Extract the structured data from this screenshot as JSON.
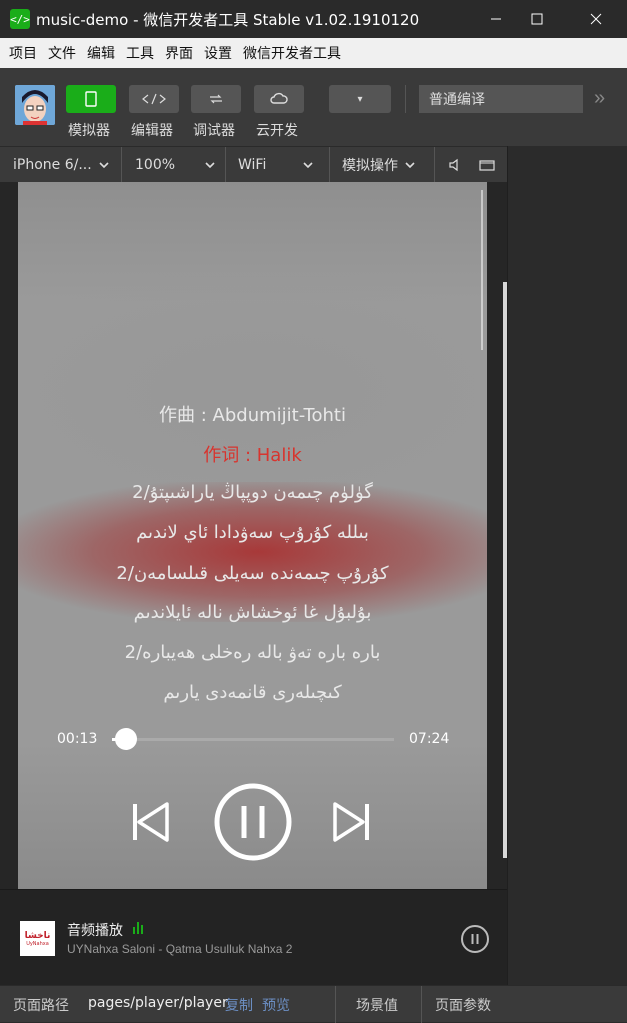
{
  "window": {
    "title": "music-demo - 微信开发者工具 Stable v1.02.1910120",
    "app_icon": "</>"
  },
  "menu": [
    "项目",
    "文件",
    "编辑",
    "工具",
    "界面",
    "设置",
    "微信开发者工具"
  ],
  "toolbar": {
    "buttons": [
      {
        "label": "模拟器",
        "icon": "phone-icon"
      },
      {
        "label": "编辑器",
        "icon": "code-icon"
      },
      {
        "label": "调试器",
        "icon": "debug-icon"
      },
      {
        "label": "云开发",
        "icon": "cloud-icon"
      }
    ],
    "compile_mode": "普通编译",
    "more": "»"
  },
  "simulator": {
    "device": "iPhone 6/...",
    "zoom": "100%",
    "network": "WiFi",
    "operation": "模拟操作"
  },
  "player": {
    "lyrics": [
      {
        "text": "作曲 : Abdumijit-Tohti",
        "active": false
      },
      {
        "text": "作词 : Halik",
        "active": true
      },
      {
        "text": "گۈلۈم چىمەن دوپپاڭ ياراشىپتۇ/2",
        "active": false
      },
      {
        "text": "بىللە كۇرۇپ سەۋدادا ئاي لاندىم",
        "active": false
      },
      {
        "text": "كۇرۇپ چىمەندە سەيلى قىلسامەن/2",
        "active": false
      },
      {
        "text": "بۇلبۇل غا ئوخشاش ناله ئايلاندىم",
        "active": false
      },
      {
        "text": "باره باره تەۋ باله رەخلى ھەيباره/2",
        "active": false
      },
      {
        "text": "كىچىلەرى قانمەدى يارىم",
        "active": false
      }
    ],
    "current_time": "00:13",
    "total_time": "07:24",
    "progress": 0.03
  },
  "mini_player": {
    "title": "音频播放",
    "subtitle": "UYNahxa Saloni - Qatma Usulluk Nahxa 2",
    "cover_text": "ناخشا",
    "cover_sub": "UyNahxa"
  },
  "status": {
    "path_label": "页面路径",
    "path": "pages/player/player",
    "copy": "复制",
    "preview": "预览",
    "scene": "场景值",
    "params": "页面参数"
  },
  "colors": {
    "accent": "#1aad19",
    "lyric_active": "#d8342e",
    "link": "#6c8fc4"
  }
}
